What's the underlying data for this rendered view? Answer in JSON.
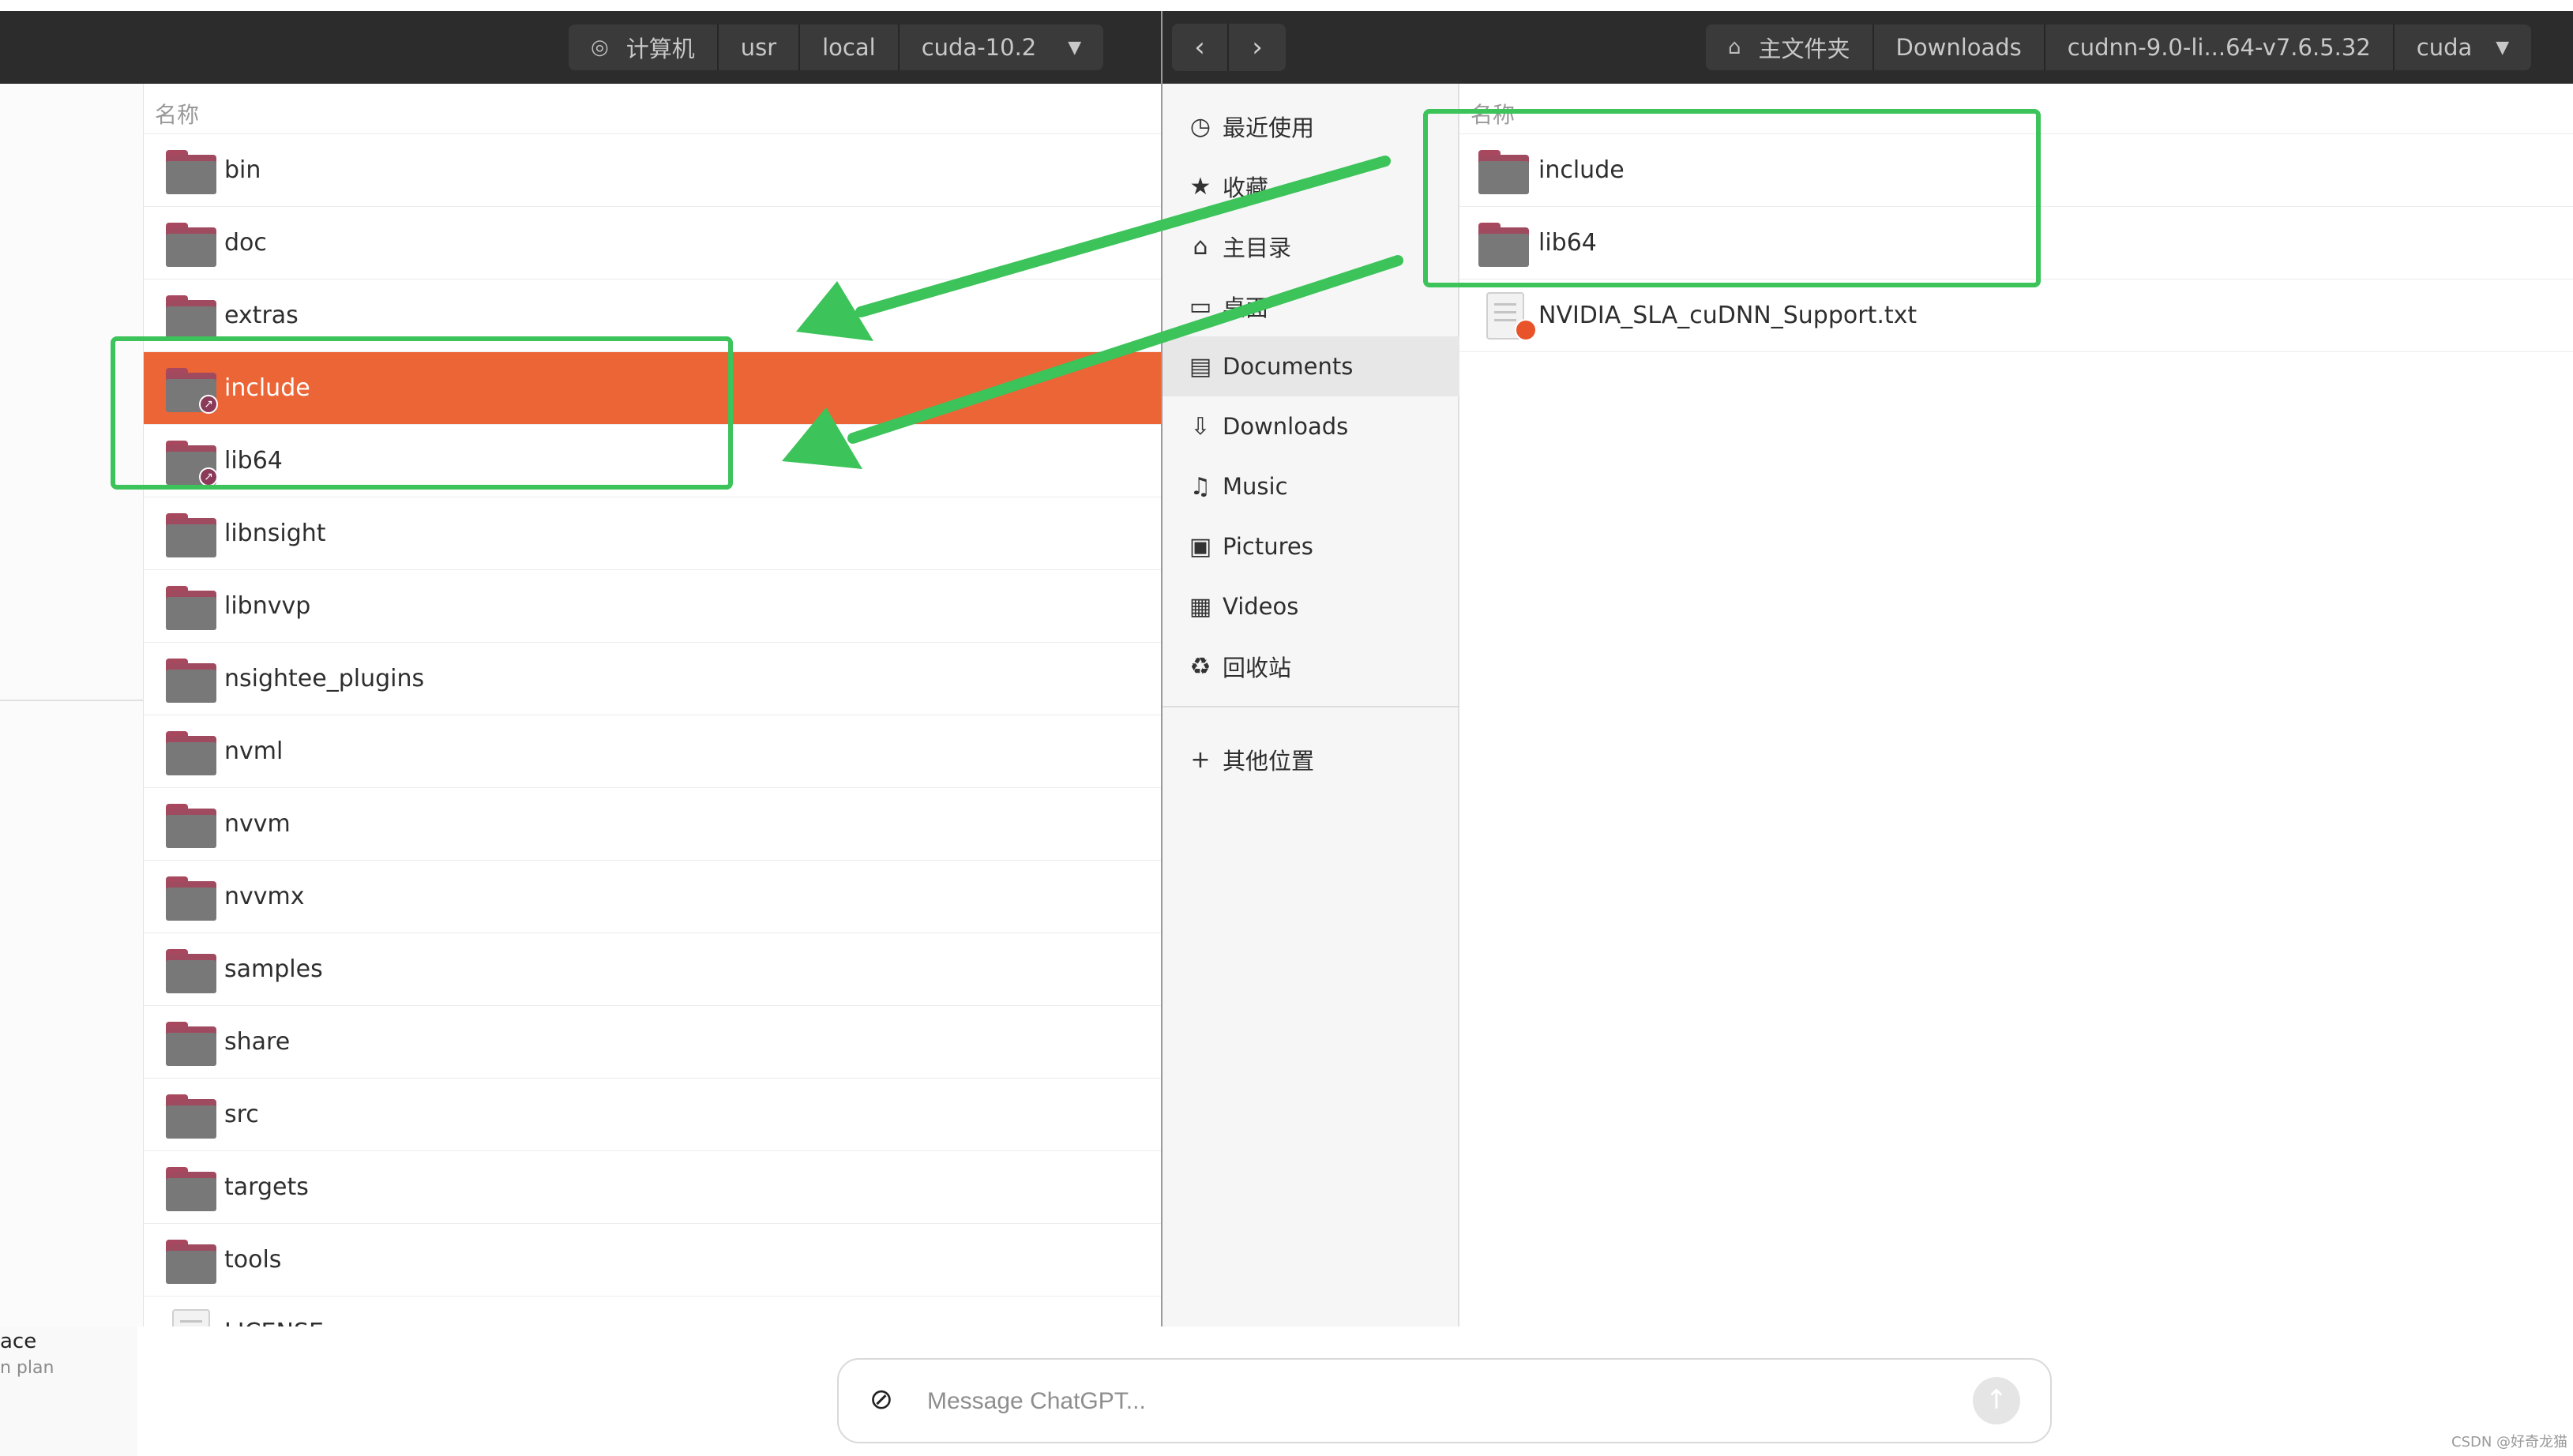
{
  "left_window": {
    "path": [
      {
        "icon": "drive-icon",
        "label": "计算机"
      },
      {
        "label": "usr"
      },
      {
        "label": "local"
      },
      {
        "label": "cuda-10.2",
        "dropdown": true
      }
    ],
    "column_header": "名称",
    "rows": [
      {
        "name": "bin",
        "type": "folder"
      },
      {
        "name": "doc",
        "type": "folder"
      },
      {
        "name": "extras",
        "type": "folder"
      },
      {
        "name": "include",
        "type": "folder-link",
        "selected": true
      },
      {
        "name": "lib64",
        "type": "folder-link"
      },
      {
        "name": "libnsight",
        "type": "folder"
      },
      {
        "name": "libnvvp",
        "type": "folder"
      },
      {
        "name": "nsightee_plugins",
        "type": "folder"
      },
      {
        "name": "nvml",
        "type": "folder"
      },
      {
        "name": "nvvm",
        "type": "folder"
      },
      {
        "name": "nvvmx",
        "type": "folder"
      },
      {
        "name": "samples",
        "type": "folder"
      },
      {
        "name": "share",
        "type": "folder"
      },
      {
        "name": "src",
        "type": "folder"
      },
      {
        "name": "targets",
        "type": "folder"
      },
      {
        "name": "tools",
        "type": "folder"
      },
      {
        "name": "LICENSE",
        "type": "text-file"
      }
    ]
  },
  "right_window": {
    "nav": {
      "back": "‹",
      "forward": "›"
    },
    "path": [
      {
        "icon": "home-icon",
        "label": "主文件夹"
      },
      {
        "label": "Downloads"
      },
      {
        "label": "cudnn-9.0-li...64-v7.6.5.32"
      },
      {
        "label": "cuda",
        "dropdown": true
      }
    ],
    "sidebar": [
      {
        "icon": "recent-icon",
        "glyph": "◷",
        "label": "最近使用"
      },
      {
        "icon": "star-icon",
        "glyph": "★",
        "label": "收藏"
      },
      {
        "icon": "home-icon",
        "glyph": "⌂",
        "label": "主目录"
      },
      {
        "icon": "desktop-icon",
        "glyph": "▭",
        "label": "桌面"
      },
      {
        "icon": "documents-icon",
        "glyph": "▤",
        "label": "Documents",
        "active": true
      },
      {
        "icon": "downloads-icon",
        "glyph": "⇩",
        "label": "Downloads"
      },
      {
        "icon": "music-icon",
        "glyph": "♫",
        "label": "Music"
      },
      {
        "icon": "pictures-icon",
        "glyph": "▣",
        "label": "Pictures"
      },
      {
        "icon": "videos-icon",
        "glyph": "▦",
        "label": "Videos"
      },
      {
        "icon": "trash-icon",
        "glyph": "♻",
        "label": "回收站"
      }
    ],
    "other_locations": {
      "icon": "plus-icon",
      "glyph": "+",
      "label": "其他位置"
    },
    "column_header": "名称",
    "rows": [
      {
        "name": "include",
        "type": "folder"
      },
      {
        "name": "lib64",
        "type": "folder"
      },
      {
        "name": "NVIDIA_SLA_cuDNN_Support.txt",
        "type": "locked-text-file"
      }
    ]
  },
  "chat": {
    "sidebar_line1": "ace",
    "sidebar_line2": "n plan",
    "placeholder": "Message ChatGPT...",
    "attach_icon": "paperclip-icon",
    "send_icon": "arrow-up-icon"
  },
  "watermark": "CSDN @好奇龙猫",
  "colors": {
    "selection": "#ec6536",
    "highlight": "#3cc35a",
    "header_bg": "#2c2c2c",
    "folder_gray": "#787878",
    "folder_accent": "#a04a60"
  }
}
